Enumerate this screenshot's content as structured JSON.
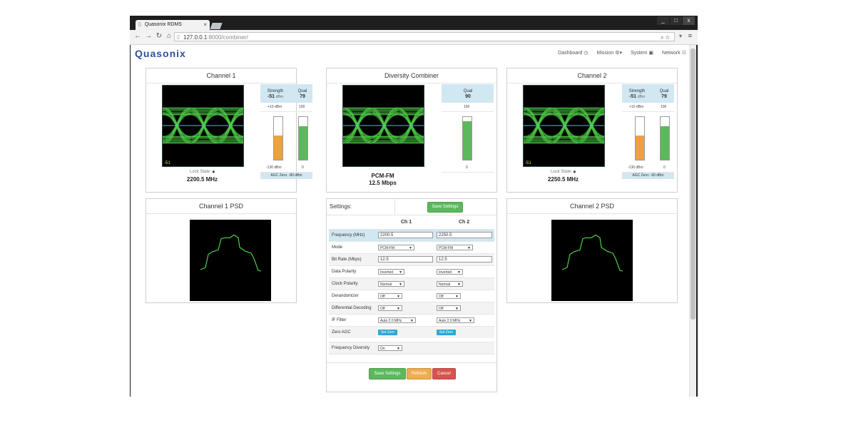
{
  "browser": {
    "tab_title": "Quasonix RDMS",
    "tab_close": "×",
    "url_host": "127.0.0.1",
    "url_path": ":8000/combiner/",
    "win_min": "_",
    "win_max": "□",
    "win_close": "x"
  },
  "app": {
    "logo": "Quasonix",
    "nav": [
      {
        "label": "Dashboard",
        "icon": "clock-icon"
      },
      {
        "label": "Mission",
        "icon": "gear-icon"
      },
      {
        "label": "System",
        "icon": "monitor-icon"
      },
      {
        "label": "Network",
        "icon": "list-icon"
      }
    ]
  },
  "channel1": {
    "title": "Channel 1",
    "strength_label": "Strength",
    "strength_value": "-51",
    "strength_unit": "dBm",
    "qual_label": "Qual",
    "qual_value": "79",
    "scale_top_left": "+10 dBm",
    "scale_top_right": "100",
    "scale_bottom_left": "-130 dBm",
    "scale_bottom_right": "0",
    "strength_fill": 0.56,
    "qual_fill": 0.79,
    "agc": "AGC Zero: -80 dBm",
    "eye_label": "-51",
    "lock_state": "Lock State:",
    "frequency": "2200.5 MHz",
    "psd_title": "Channel 1 PSD"
  },
  "combiner": {
    "title": "Diversity Combiner",
    "qual_label": "Qual",
    "qual_value": "90",
    "scale_top": "100",
    "scale_bottom": "0",
    "qual_fill": 0.9,
    "mode": "PCM-FM",
    "bitrate": "12.5 Mbps"
  },
  "channel2": {
    "title": "Channel 2",
    "strength_label": "Strength",
    "strength_value": "-51",
    "strength_unit": "dBm",
    "qual_label": "Qual",
    "qual_value": "79",
    "scale_top_left": "+10 dBm",
    "scale_top_right": "100",
    "scale_bottom_left": "-130 dBm",
    "scale_bottom_right": "0",
    "strength_fill": 0.56,
    "qual_fill": 0.79,
    "agc": "AGC Zero: -90 dBm",
    "eye_label": "-51",
    "lock_state": "Lock State:",
    "frequency": "2250.5 MHz",
    "psd_title": "Channel 2 PSD"
  },
  "settings": {
    "title": "Settings:",
    "save_top": "Save Settings",
    "ch1_header": "Ch 1",
    "ch2_header": "Ch 2",
    "rows": [
      {
        "label": "Frequency (MHz)",
        "ch1": "2200.5",
        "ch2": "2250.5"
      },
      {
        "label": "Mode",
        "ch1": "PCM-FM",
        "ch2": "PCM-FM"
      },
      {
        "label": "Bit Rate (Mbps)",
        "ch1": "12.5",
        "ch2": "12.5"
      },
      {
        "label": "Data Polarity",
        "ch1": "Inverted",
        "ch2": "Inverted"
      },
      {
        "label": "Clock Polarity",
        "ch1": "Normal",
        "ch2": "Normal"
      },
      {
        "label": "Derandomizer",
        "ch1": "Off",
        "ch2": "Off"
      },
      {
        "label": "Differential Decoding",
        "ch1": "Off",
        "ch2": "Off"
      },
      {
        "label": "IF Filter",
        "ch1": "Auto 2.0 MHz",
        "ch2": "Auto 2.0 MHz"
      },
      {
        "label": "Zero AGC",
        "ch1": "Set Zero",
        "ch2": "Set Zero"
      }
    ],
    "freq_diversity_label": "Frequency Diversity",
    "freq_diversity_value": "On",
    "save_bottom": "Save Settings",
    "refresh": "Refresh",
    "cancel": "Cancel"
  },
  "colors": {
    "accent_green": "#5cb85c",
    "eye_green": "#4fd04a",
    "meter_orange": "#f0a040",
    "header_blue": "#d1e7f2",
    "logo_red": "#c62d2d"
  }
}
